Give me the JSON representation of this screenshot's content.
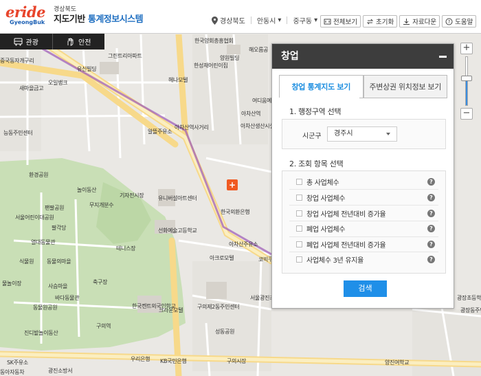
{
  "header": {
    "logo_text": "eride",
    "logo_sub": "GyeongBuk",
    "province_label": "경상북도",
    "system_title_prefix": "지도기반 ",
    "system_title_highlight": "통계정보시스템"
  },
  "location": {
    "province": "경상북도",
    "city": "안동시",
    "district": "중구동"
  },
  "toolbar": {
    "fullview": "전체보기",
    "reset": "초기화",
    "download": "자료다운",
    "help": "도움말"
  },
  "map_tabs": {
    "tourism": "관광",
    "safety": "안전"
  },
  "panel": {
    "title": "창업",
    "tabs": [
      "창업 통계지도 보기",
      "주변상권 위치정보 보기"
    ],
    "section1": "1. 행정구역 선택",
    "sigungu_label": "시군구",
    "sigungu_value": "경주시",
    "section2": "2. 조회 항목 선택",
    "items": [
      "총 사업체수",
      "창업 사업체수",
      "창업 사업체 전년대비 증가율",
      "폐업 사업체수",
      "폐업 사업체 전년대비 증가율",
      "사업체수 3년 유지율"
    ],
    "search_button": "검색"
  },
  "zoom": {
    "level_fraction": 0.55
  },
  "map_labels": [
    "한국양회총흥협회",
    "해오름공",
    "그린트리아파트",
    "유신빌딩",
    "오일뱅크",
    "새마을금고",
    "중국동자개구리",
    "헤나모텔",
    "양원빌딩",
    "한성재어린이집",
    "여디움예",
    "아차산역",
    "알뜰주유소",
    "아차산역사거리",
    "아차산생산시설",
    "능동주민센터",
    "환경공원",
    "놀이동산",
    "기자전시장",
    "무지개분수",
    "팬팔공원",
    "서울어린이대공원",
    "팔각당",
    "열대동물관",
    "식물원",
    "동물의마을",
    "사슴마을",
    "물놀이장",
    "바다동물관",
    "동물원공원",
    "진디밭놀이동산",
    "유니버설아트센터",
    "선화예술고등학교",
    "테니스장",
    "아크로모텔",
    "코빅쿠",
    "축구장",
    "한국켄트외국인학교",
    "크라운모텔",
    "구의제2동주민센터",
    "서울광진초등학교",
    "성동공원",
    "구의역",
    "KB국민은행",
    "우리은행",
    "광진소방서",
    "양진여학교",
    "동아자동차",
    "SK주유소",
    "한국외환은행",
    "아차산주유소",
    "광장초등학교",
    "광장동주민",
    "구의시장"
  ]
}
